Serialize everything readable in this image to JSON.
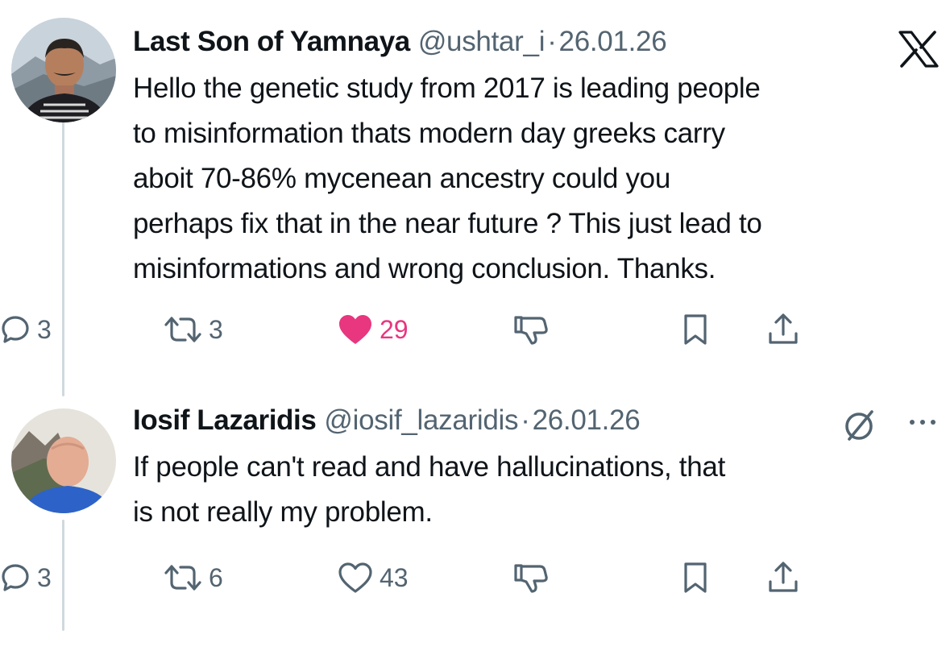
{
  "thread": {
    "tweets": [
      {
        "author_name": "Last Son of Yamnaya",
        "handle": "@ushtar_i",
        "separator": "·",
        "date": "26.01.26",
        "text": "Hello the genetic study from 2017 is leading people\nto misinformation thats modern day greeks carry\naboit 70-86% mycenean ancestry could you\nperhaps fix that in the near future ? This just lead to\nmisinformations and wrong conclusion. Thanks.",
        "corner_icon": "x-logo-icon",
        "replies": "3",
        "retweets": "3",
        "likes": "29",
        "liked": true,
        "like_color": "#f91880"
      },
      {
        "author_name": "Iosif Lazaridis",
        "handle": "@iosif_lazaridis",
        "separator": "·",
        "date": "26.01.26",
        "text": "If people can't read and have hallucinations, that\nis not really my problem.",
        "corner_icons": [
          "grok-icon",
          "more-icon"
        ],
        "replies": "3",
        "retweets": "6",
        "likes": "43",
        "liked": false
      }
    ]
  },
  "colors": {
    "text": "#0f1419",
    "secondary": "#536471",
    "thread_line": "#cfd9de",
    "like_active": "#e8367f"
  }
}
